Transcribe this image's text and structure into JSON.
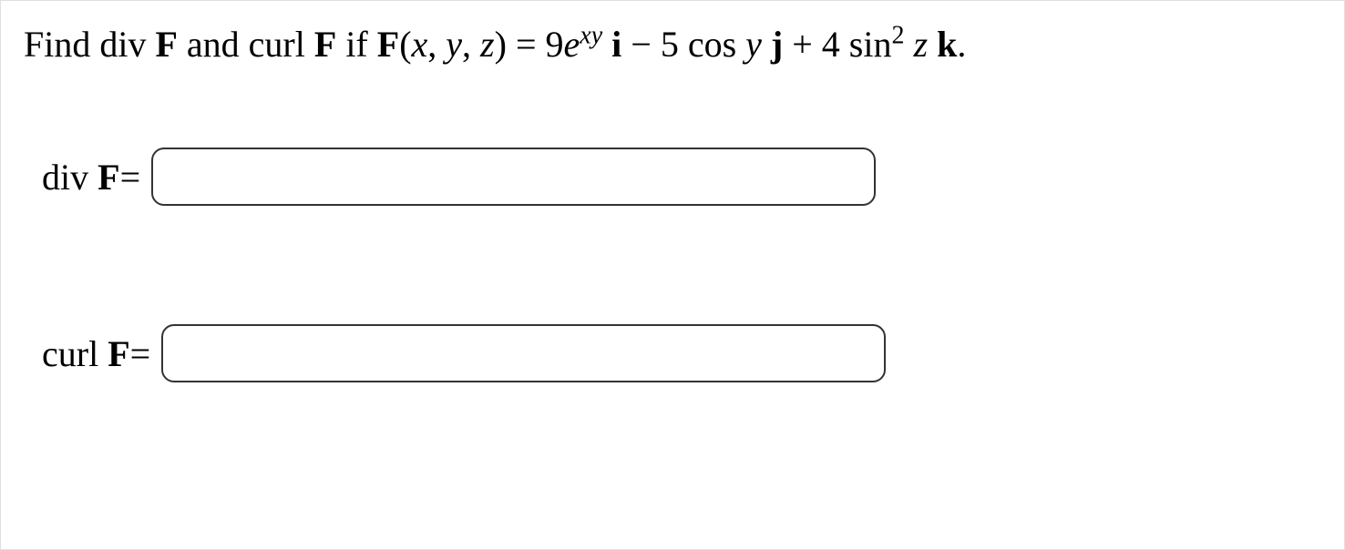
{
  "problem": {
    "prefix": "Find div ",
    "F1": "F",
    "mid1": " and curl ",
    "F2": "F",
    "mid2": " if ",
    "F3": "F",
    "args": "(",
    "x": "x",
    "c1": ", ",
    "y": "y",
    "c2": ", ",
    "z": "z",
    "argsend": ") = 9",
    "e": "e",
    "exp_xy": "xy",
    "sp1": " ",
    "i": "i",
    "minus": " − 5 cos ",
    "y2": "y",
    "sp2": " ",
    "j": "j",
    "plus": " + 4 sin",
    "sq": "2",
    "sp3": " ",
    "z2": "z",
    "sp4": " ",
    "k": "k",
    "period": "."
  },
  "answers": {
    "div": {
      "label_pre": "div ",
      "label_F": "F",
      "label_eq": "=",
      "value": ""
    },
    "curl": {
      "label_pre": "curl ",
      "label_F": "F",
      "label_eq": "=",
      "value": ""
    }
  }
}
